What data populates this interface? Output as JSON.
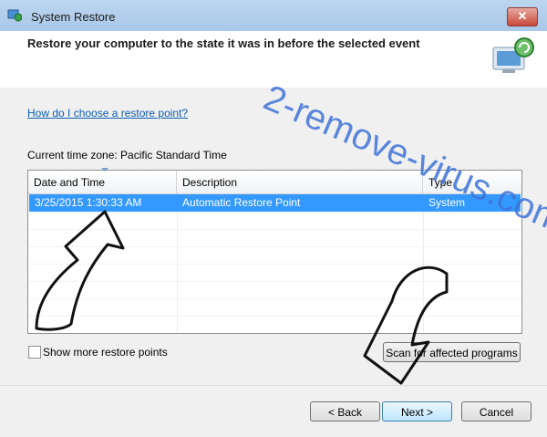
{
  "window": {
    "title": "System Restore",
    "close_label": "✕"
  },
  "header": {
    "heading": "Restore your computer to the state it was in before the selected event"
  },
  "help_link": "How do I choose a restore point?",
  "timezone_text": "Current time zone: Pacific Standard Time",
  "table": {
    "columns": [
      "Date and Time",
      "Description",
      "Type"
    ],
    "rows": [
      {
        "date": "3/25/2015 1:30:33 AM",
        "description": "Automatic Restore Point",
        "type": "System"
      }
    ]
  },
  "show_more_label": "Show more restore points",
  "scan_button_label": "Scan for affected programs",
  "buttons": {
    "back": "< Back",
    "next": "Next >",
    "cancel": "Cancel"
  },
  "watermark": "2-remove-virus.com",
  "colors": {
    "selection": "#3399ff",
    "link": "#0b5bb3",
    "watermark": "#3f74d8"
  }
}
